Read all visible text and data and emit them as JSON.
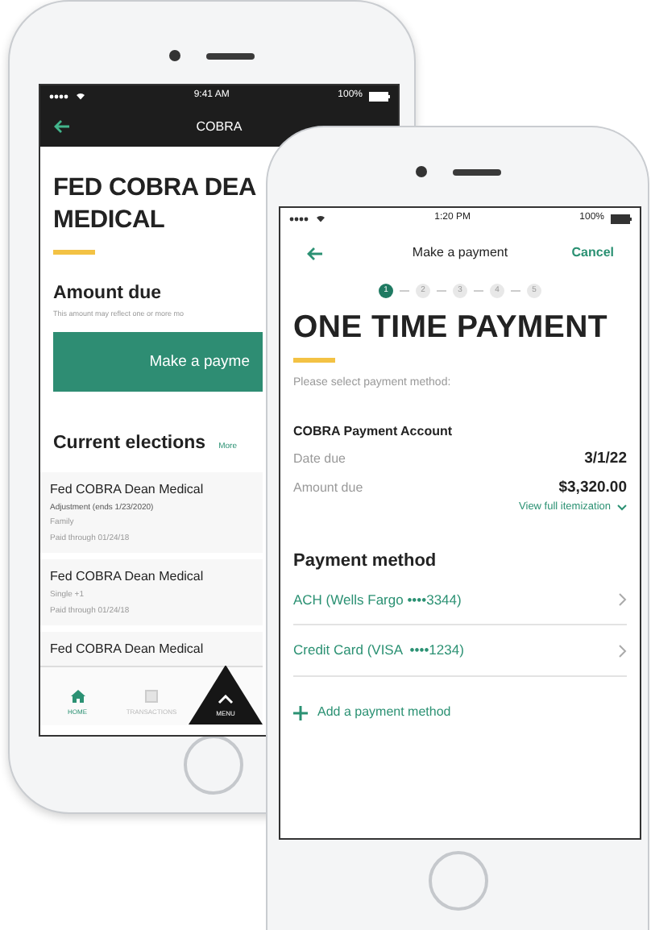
{
  "back_phone": {
    "status_bar": {
      "time": "9:41 AM",
      "battery": "100%"
    },
    "header": {
      "title": "COBRA"
    },
    "title_lines": [
      "FED COBRA DEA",
      "MEDICAL"
    ],
    "amount_due": {
      "heading": "Amount due",
      "note": "This amount may reflect one or more mo"
    },
    "pay_button": "Make a payme",
    "elections": {
      "heading": "Current elections",
      "more": "More",
      "items": [
        {
          "name": "Fed COBRA Dean Medical",
          "adjustment": "Adjustment (ends 1/23/2020)",
          "details": [
            "Family",
            "Paid through 01/24/18"
          ]
        },
        {
          "name": "Fed COBRA Dean Medical",
          "details": [
            "Single +1",
            "Paid through 01/24/18"
          ]
        },
        {
          "name": "Fed COBRA Dean Medical"
        }
      ]
    },
    "tab_bar": [
      {
        "kind": "home",
        "label": "HOME",
        "selected": true
      },
      {
        "kind": "transactions",
        "label": "TRANSACTIONS",
        "selected": false
      },
      {
        "kind": "menu",
        "label": "MENU",
        "selected": false
      }
    ]
  },
  "front_phone": {
    "status_bar": {
      "time": "1:20 PM",
      "battery": "100%"
    },
    "header": {
      "title": "Make a payment",
      "action": "Cancel"
    },
    "steps": [
      {
        "label": "1",
        "selected": true
      },
      {
        "label": "2",
        "selected": false
      },
      {
        "label": "3",
        "selected": false
      },
      {
        "label": "4",
        "selected": false
      },
      {
        "label": "5",
        "selected": false
      }
    ],
    "title": "ONE TIME PAYMENT",
    "prompt": "Please select payment method:",
    "account": {
      "heading": "COBRA Payment Account",
      "rows": [
        {
          "label": "Date due",
          "value": "3/1/22"
        },
        {
          "label": "Amount due",
          "value": "$3,320.00"
        }
      ],
      "link": "View full itemization"
    },
    "payment_method": {
      "heading": "Payment method",
      "options": [
        "ACH (Wells Fargo ••••3344)",
        "Credit Card (VISA  ••••1234)"
      ],
      "add": "Add a payment method"
    }
  }
}
